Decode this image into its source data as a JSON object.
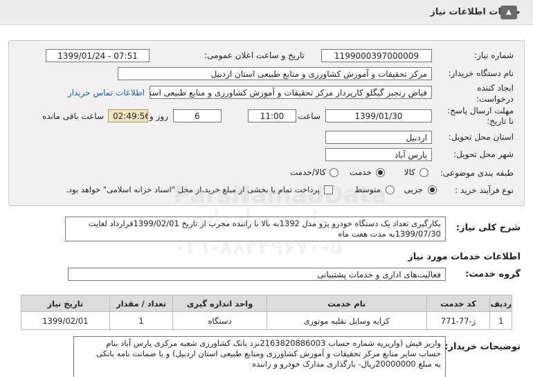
{
  "header": {
    "title": "جزئیات اطلاعات نیاز",
    "collapse_icon": "chevron-up-icon"
  },
  "form": {
    "need_number": {
      "label": "شماره نیاز:",
      "value": "1199000397000009"
    },
    "announce_datetime": {
      "label": "تاریخ و ساعت اعلان عمومی:",
      "value": "1399/01/24 - 07:51"
    },
    "buyer_org": {
      "label": "نام دستگاه خریدار:",
      "value": "مرکز تحقیقات و آموزش کشاورزی و منابع طبیعی استان اردبیل"
    },
    "requester": {
      "label_line1": "ایجاد کننده",
      "label_line2": "درخواست:",
      "value": "فیاض رنجبر گیگلو کارپرداز مرکز تحقیقات و آموزش کشاورزی و منابع طبیعی استان اردبیل",
      "contact_link": "اطلاعات تماس خریدار"
    },
    "deadline": {
      "label_line1": "مهلت ارسال پاسخ:",
      "label_line2": "تا تاریخ:",
      "date": "1399/01/30",
      "time_label": "ساعت",
      "time": "11:00",
      "days": "6",
      "days_label": "روز و",
      "remaining": "02:49:56",
      "remaining_label": "ساعت باقی مانده"
    },
    "province": {
      "label": "استان محل تحویل:",
      "value": "اردبیل"
    },
    "city": {
      "label": "شهر محل تحویل:",
      "value": "پارس آباد"
    },
    "category": {
      "label": "طبقه بندی موضوعی:",
      "options": [
        "کالا",
        "خدمت",
        "کالا/خدمت"
      ],
      "selected": "خدمت"
    },
    "purchase_type": {
      "label": "نوع فرآیند خرید :",
      "options": [
        "جزیی",
        "متوسط"
      ],
      "selected": "جزیی",
      "note": "پرداخت تمام یا بخشی از مبلغ خرید،از محل \"اسناد خزانه اسلامی\" خواهد بود."
    }
  },
  "summary": {
    "label": "شرح کلی نیاز:",
    "line1": "بکارگیری تعداد یک دستگاه خودرو پژو مدل  1392به بالا با راننده مجرب از تاریخ  1399/02/01قرارداد لغایت",
    "line2": "1399/07/30به مدت هفت ماه"
  },
  "services": {
    "title": "اطلاعات خدمات مورد نیاز",
    "group_label": "گروه خدمت:",
    "group_value": "فعالیت‌های اداری و خدمات پشتیبانی",
    "columns": [
      "ردیف",
      "کد خدمت",
      "نام خدمت",
      "واحد اندازه گیری",
      "تعداد / مقدار",
      "تاریخ نیاز"
    ],
    "rows": [
      {
        "index": "1",
        "code": "ز-77-771",
        "name": "کرایه وسایل نقلیه موتوری",
        "unit": "دستگاه",
        "qty": "1",
        "date": "1399/02/01"
      }
    ]
  },
  "buyer_notes": {
    "label": "توضیحات خریدار:",
    "line1": "واریز فیش (واریزیه شماره حساب  2163820886003نزد بانک کشاورزی شعبه مرکزی پارس آباد بنام",
    "line2": "حساب سایر منابع مرکز تحقیقات و آموزش کشاورزی ومنابع طبیعی استان اردبیل) و یا ضمانت نامه بانکی",
    "line3": "به مبلغ  20000000ریال- بارگذاری مدارک خودرو و راننده"
  },
  "watermarks": {
    "brand": "ParsNamadData",
    "brand_fa": "پارس نماد داده",
    "phone": "۰۲۱-۸۸۳۴۹۶۷۰-۵"
  }
}
